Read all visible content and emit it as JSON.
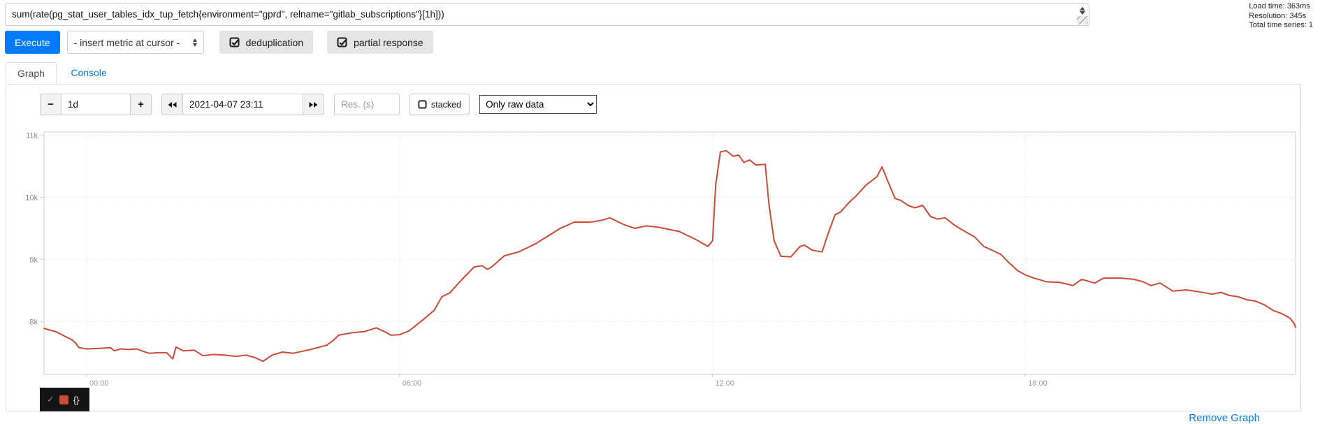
{
  "query_bar": {
    "query": "sum(rate(pg_stat_user_tables_idx_tup_fetch{environment=\"gprd\", relname=\"gitlab_subscriptions\"}[1h]))"
  },
  "stats": {
    "load_time": "Load time: 363ms",
    "resolution": "Resolution: 345s",
    "total_series": "Total time series: 1"
  },
  "toolbar": {
    "execute_label": "Execute",
    "insert_metric_label": "- insert metric at cursor -",
    "deduplication_label": "deduplication",
    "partial_response_label": "partial response"
  },
  "tabs": {
    "graph": "Graph",
    "console": "Console"
  },
  "graph_controls": {
    "minus_label": "−",
    "plus_label": "+",
    "range_value": "1d",
    "datetime_value": "2021-04-07 23:11",
    "res_placeholder": "Res. (s)",
    "stacked_label": "stacked",
    "raw_data_selected": "Only raw data"
  },
  "icons": {
    "spinner_up": "▲",
    "spinner_down": "▼",
    "select_updown": "⇕",
    "checkbox_checked": "☑",
    "checkbox_unchecked": "☐",
    "rewind": "◀◀",
    "fast_forward": "▶▶",
    "legend_check": "✓"
  },
  "legend": {
    "check": "✓",
    "series_label": "{}"
  },
  "footer": {
    "remove_graph_label": "Remove Graph"
  },
  "colors": {
    "accent_blue": "#007bff",
    "series": "#cc4a38",
    "grid": "#e0e0e0",
    "plot_border": "#cccccc",
    "y_label": "#8a8a8a",
    "x_label": "#999999"
  },
  "chart_data": {
    "type": "line",
    "title": "",
    "xlabel": "",
    "ylabel": "",
    "grid": true,
    "legend_position": "bottom-left",
    "x_range_hours": [
      0,
      24
    ],
    "x_start_time": "2021-04-06 23:11",
    "x_end_time": "2021-04-07 23:11",
    "x_ticks": [
      {
        "label": "00:00",
        "hour": 0.8167
      },
      {
        "label": "06:00",
        "hour": 6.8167
      },
      {
        "label": "12:00",
        "hour": 12.8167
      },
      {
        "label": "18:00",
        "hour": 18.8167
      }
    ],
    "y_range": [
      7.15,
      11.05
    ],
    "y_ticks": [
      {
        "label": "8k",
        "value": 8
      },
      {
        "label": "9k",
        "value": 9
      },
      {
        "label": "10k",
        "value": 10
      },
      {
        "label": "11k",
        "value": 11
      }
    ],
    "y_unit": "thousands (tuples fetched per second)",
    "series": [
      {
        "name": "{}",
        "color": "#cc4a38",
        "points": [
          [
            0,
            7.89
          ],
          [
            0.22,
            7.84
          ],
          [
            0.43,
            7.75
          ],
          [
            0.53,
            7.71
          ],
          [
            0.6,
            7.66
          ],
          [
            0.67,
            7.58
          ],
          [
            0.82,
            7.56
          ],
          [
            1.08,
            7.57
          ],
          [
            1.27,
            7.58
          ],
          [
            1.35,
            7.53
          ],
          [
            1.47,
            7.56
          ],
          [
            1.62,
            7.55
          ],
          [
            1.78,
            7.56
          ],
          [
            1.9,
            7.52
          ],
          [
            2.02,
            7.49
          ],
          [
            2.2,
            7.5
          ],
          [
            2.35,
            7.5
          ],
          [
            2.47,
            7.4
          ],
          [
            2.53,
            7.59
          ],
          [
            2.67,
            7.53
          ],
          [
            2.88,
            7.54
          ],
          [
            3.05,
            7.45
          ],
          [
            3.25,
            7.47
          ],
          [
            3.47,
            7.46
          ],
          [
            3.68,
            7.44
          ],
          [
            3.88,
            7.46
          ],
          [
            4.05,
            7.42
          ],
          [
            4.2,
            7.36
          ],
          [
            4.37,
            7.46
          ],
          [
            4.57,
            7.51
          ],
          [
            4.78,
            7.49
          ],
          [
            5,
            7.53
          ],
          [
            5.2,
            7.57
          ],
          [
            5.42,
            7.62
          ],
          [
            5.55,
            7.7
          ],
          [
            5.65,
            7.78
          ],
          [
            5.9,
            7.82
          ],
          [
            6.15,
            7.84
          ],
          [
            6.37,
            7.9
          ],
          [
            6.55,
            7.83
          ],
          [
            6.65,
            7.78
          ],
          [
            6.82,
            7.79
          ],
          [
            7,
            7.85
          ],
          [
            7.27,
            8.03
          ],
          [
            7.48,
            8.18
          ],
          [
            7.63,
            8.4
          ],
          [
            7.78,
            8.46
          ],
          [
            7.95,
            8.62
          ],
          [
            8.03,
            8.69
          ],
          [
            8.25,
            8.88
          ],
          [
            8.4,
            8.9
          ],
          [
            8.5,
            8.84
          ],
          [
            8.57,
            8.87
          ],
          [
            8.83,
            9.06
          ],
          [
            9.1,
            9.12
          ],
          [
            9.42,
            9.25
          ],
          [
            9.73,
            9.41
          ],
          [
            9.9,
            9.5
          ],
          [
            10.17,
            9.6
          ],
          [
            10.48,
            9.6
          ],
          [
            10.7,
            9.63
          ],
          [
            10.85,
            9.67
          ],
          [
            11.12,
            9.56
          ],
          [
            11.33,
            9.5
          ],
          [
            11.55,
            9.54
          ],
          [
            11.77,
            9.52
          ],
          [
            12.18,
            9.45
          ],
          [
            12.5,
            9.32
          ],
          [
            12.65,
            9.25
          ],
          [
            12.73,
            9.21
          ],
          [
            12.82,
            9.3
          ],
          [
            12.88,
            10.2
          ],
          [
            12.97,
            10.73
          ],
          [
            13.08,
            10.75
          ],
          [
            13.22,
            10.66
          ],
          [
            13.32,
            10.68
          ],
          [
            13.42,
            10.56
          ],
          [
            13.53,
            10.6
          ],
          [
            13.65,
            10.52
          ],
          [
            13.83,
            10.53
          ],
          [
            13.9,
            9.9
          ],
          [
            14,
            9.3
          ],
          [
            14.13,
            9.05
          ],
          [
            14.32,
            9.04
          ],
          [
            14.5,
            9.21
          ],
          [
            14.58,
            9.23
          ],
          [
            14.73,
            9.15
          ],
          [
            14.92,
            9.12
          ],
          [
            15.05,
            9.45
          ],
          [
            15.17,
            9.72
          ],
          [
            15.27,
            9.76
          ],
          [
            15.43,
            9.91
          ],
          [
            15.57,
            10.02
          ],
          [
            15.77,
            10.2
          ],
          [
            15.97,
            10.33
          ],
          [
            16.07,
            10.49
          ],
          [
            16.18,
            10.26
          ],
          [
            16.32,
            9.98
          ],
          [
            16.43,
            9.95
          ],
          [
            16.57,
            9.87
          ],
          [
            16.7,
            9.83
          ],
          [
            16.85,
            9.87
          ],
          [
            17,
            9.69
          ],
          [
            17.13,
            9.65
          ],
          [
            17.28,
            9.67
          ],
          [
            17.48,
            9.54
          ],
          [
            17.7,
            9.43
          ],
          [
            17.85,
            9.36
          ],
          [
            18.02,
            9.21
          ],
          [
            18.2,
            9.14
          ],
          [
            18.35,
            9.08
          ],
          [
            18.5,
            8.95
          ],
          [
            18.67,
            8.82
          ],
          [
            18.82,
            8.75
          ],
          [
            18.98,
            8.7
          ],
          [
            19.23,
            8.64
          ],
          [
            19.48,
            8.63
          ],
          [
            19.73,
            8.58
          ],
          [
            19.9,
            8.68
          ],
          [
            20.15,
            8.62
          ],
          [
            20.32,
            8.7
          ],
          [
            20.65,
            8.7
          ],
          [
            20.9,
            8.68
          ],
          [
            21.07,
            8.64
          ],
          [
            21.23,
            8.58
          ],
          [
            21.4,
            8.62
          ],
          [
            21.65,
            8.49
          ],
          [
            21.9,
            8.51
          ],
          [
            22.15,
            8.48
          ],
          [
            22.4,
            8.44
          ],
          [
            22.57,
            8.47
          ],
          [
            22.73,
            8.42
          ],
          [
            22.9,
            8.4
          ],
          [
            23.07,
            8.35
          ],
          [
            23.23,
            8.33
          ],
          [
            23.4,
            8.27
          ],
          [
            23.57,
            8.18
          ],
          [
            23.73,
            8.13
          ],
          [
            23.82,
            8.09
          ],
          [
            23.9,
            8.05
          ],
          [
            23.97,
            7.97
          ],
          [
            24,
            7.91
          ]
        ]
      }
    ]
  }
}
